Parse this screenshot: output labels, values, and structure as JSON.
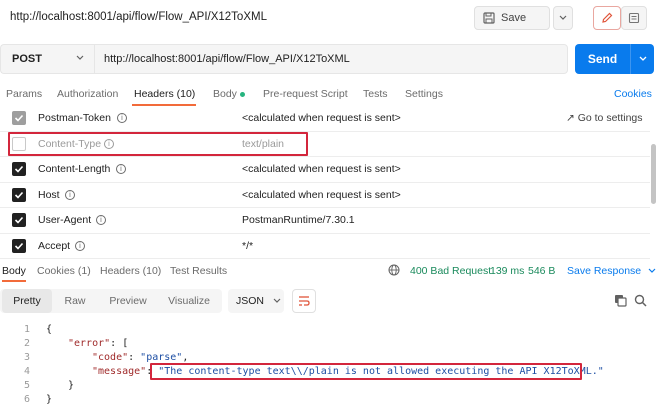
{
  "window": {
    "title": "http://localhost:8001/api/flow/Flow_API/X12ToXML"
  },
  "toolbar": {
    "save_label": "Save"
  },
  "request": {
    "method": "POST",
    "url": "http://localhost:8001/api/flow/Flow_API/X12ToXML",
    "send_label": "Send"
  },
  "request_tabs": [
    {
      "label": "Params"
    },
    {
      "label": "Authorization"
    },
    {
      "label": "Headers (10)"
    },
    {
      "label": "Body"
    },
    {
      "label": "Pre-request Script"
    },
    {
      "label": "Tests"
    },
    {
      "label": "Settings"
    }
  ],
  "cookies_link": "Cookies",
  "goto_settings": "Go to settings",
  "headers": [
    {
      "key": "Postman-Token",
      "value": "<calculated when request is sent>",
      "checked": "dim"
    },
    {
      "key": "Content-Type",
      "value": "text/plain",
      "checked": "off"
    },
    {
      "key": "Content-Length",
      "value": "<calculated when request is sent>",
      "checked": "on"
    },
    {
      "key": "Host",
      "value": "<calculated when request is sent>",
      "checked": "on"
    },
    {
      "key": "User-Agent",
      "value": "PostmanRuntime/7.30.1",
      "checked": "on"
    },
    {
      "key": "Accept",
      "value": "*/*",
      "checked": "on"
    }
  ],
  "response_tabs": [
    {
      "label": "Body"
    },
    {
      "label": "Cookies (1)"
    },
    {
      "label": "Headers (10)"
    },
    {
      "label": "Test Results"
    }
  ],
  "response_status": {
    "status": "400 Bad Request",
    "time": "139 ms",
    "size": "546 B",
    "save_label": "Save Response"
  },
  "format_tabs": [
    {
      "label": "Pretty"
    },
    {
      "label": "Raw"
    },
    {
      "label": "Preview"
    },
    {
      "label": "Visualize"
    }
  ],
  "format_select": "JSON",
  "code_lines": [
    {
      "n": "1",
      "text": "{"
    },
    {
      "n": "2",
      "key": "\"error\"",
      "rest": ": ["
    },
    {
      "n": "3",
      "key": "\"code\"",
      "sep": ": ",
      "str": "\"parse\"",
      "rest": ","
    },
    {
      "n": "4",
      "key": "\"message\"",
      "sep": ": ",
      "str": "\"The content-type text\\\\/plain is not allowed executing the API X12ToXML.\""
    },
    {
      "n": "5",
      "text": "}"
    },
    {
      "n": "6",
      "text": "}"
    }
  ],
  "colors": {
    "accent": "#097bed",
    "tab_active": "#f26b3a",
    "status_ok": "#1a8a5c",
    "highlight_box": "#d3263c"
  }
}
